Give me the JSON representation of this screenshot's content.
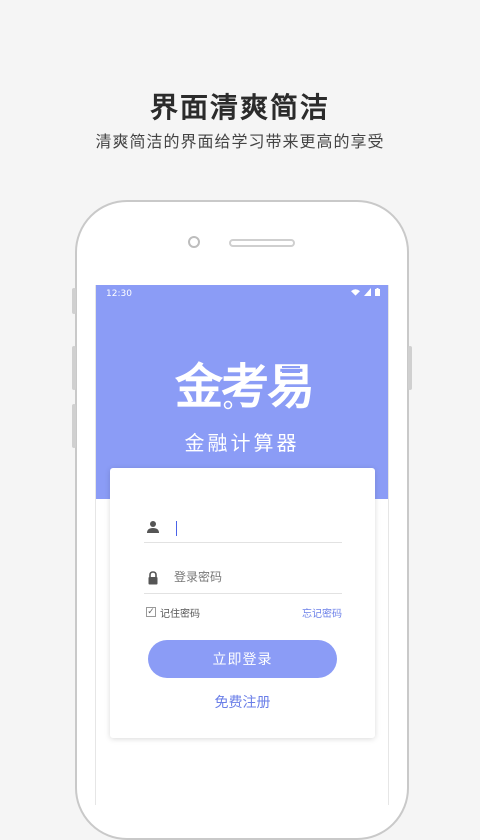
{
  "promo": {
    "headline": "界面清爽简洁",
    "subline": "清爽简洁的界面给学习带来更高的享受"
  },
  "statusbar": {
    "time": "12:30",
    "icons": [
      "wifi-icon",
      "signal-icon",
      "battery-icon"
    ]
  },
  "app": {
    "logo_text": "金考易",
    "name": "金融计算器"
  },
  "login": {
    "username_value": "",
    "password_placeholder": "登录密码",
    "remember_label": "记住密码",
    "remember_checked": true,
    "forgot_label": "忘记密码",
    "submit_label": "立即登录",
    "register_label": "免费注册"
  },
  "colors": {
    "accent": "#8b9cf6",
    "link": "#6b7fe8",
    "background": "#f5f5f5"
  }
}
